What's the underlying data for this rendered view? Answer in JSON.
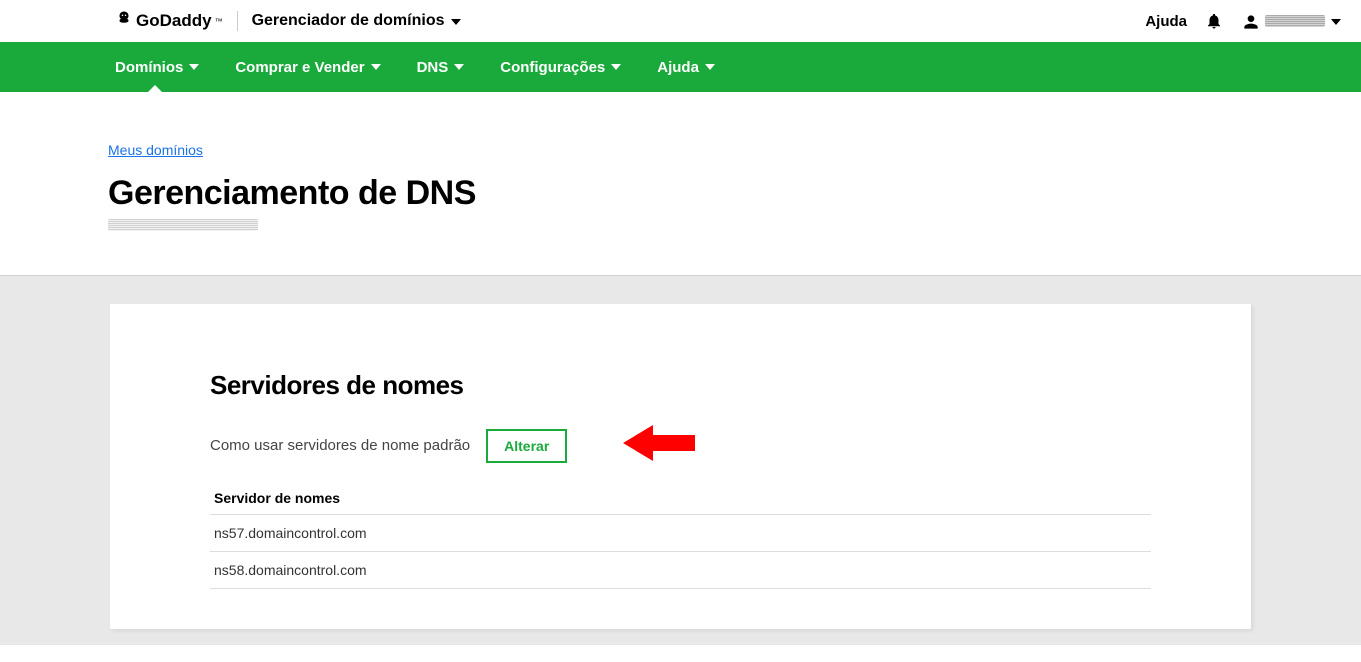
{
  "header": {
    "logo_text": "GoDaddy",
    "logo_tm": "™",
    "breadcrumb_dropdown": "Gerenciador de domínios",
    "help_label": "Ajuda"
  },
  "nav": {
    "items": [
      {
        "label": "Domínios",
        "active": true
      },
      {
        "label": "Comprar e Vender",
        "active": false
      },
      {
        "label": "DNS",
        "active": false
      },
      {
        "label": "Configurações",
        "active": false
      },
      {
        "label": "Ajuda",
        "active": false
      }
    ]
  },
  "page": {
    "breadcrumb": "Meus domínios",
    "title": "Gerenciamento de DNS"
  },
  "nameservers": {
    "section_title": "Servidores de nomes",
    "description": "Como usar servidores de nome padrão",
    "change_button": "Alterar",
    "column_header": "Servidor de nomes",
    "servers": [
      "ns57.domaincontrol.com",
      "ns58.domaincontrol.com"
    ]
  },
  "colors": {
    "brand_green": "#1aaa3b",
    "arrow_red": "#ff0000",
    "link_blue": "#1a73e8"
  }
}
